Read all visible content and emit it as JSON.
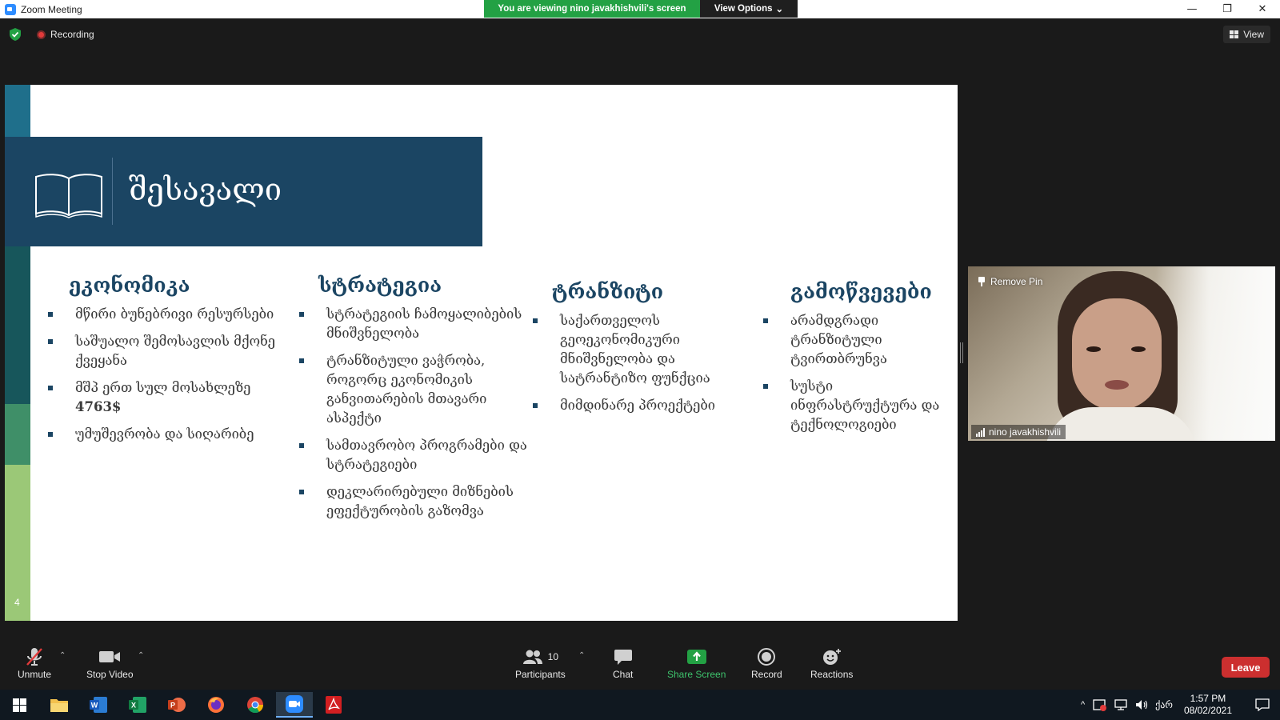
{
  "window": {
    "title": "Zoom Meeting",
    "minimize": "—",
    "maximize": "❐",
    "close": "✕"
  },
  "banner": {
    "text": "You are viewing nino javakhishvili's screen",
    "view_options": "View Options",
    "caret": "⌄"
  },
  "top": {
    "recording": "Recording",
    "view": "View"
  },
  "slide": {
    "title": "შესავალი",
    "number": "4",
    "colors": {
      "title_bg": "#1b4563",
      "accent_teal": "#1f6f8b",
      "accent_green": "#4caf7a"
    },
    "columns": [
      {
        "heading": "ეკონომიკა",
        "items": [
          "მწირი ბუნებრივი რესურსები",
          "საშუალო შემოსავლის მქონე ქვეყანა",
          "მშპ ერთ სულ მოსახლეზე",
          "უმუშევრობა და სიღარიბე"
        ],
        "emphasis": "4763$"
      },
      {
        "heading": "სტრატეგია",
        "items": [
          "სტრატეგიის ჩამოყალიბების მნიშვნელობა",
          "ტრანზიტული ვაჭრობა, როგორც ეკონომიკის განვითარების მთავარი ასპექტი",
          "სამთავრობო პროგრამები  და სტრატეგიები",
          "დეკლარირებული მიზნების ეფექტურობის გაზომვა"
        ]
      },
      {
        "heading": "ტრანზიტი",
        "items": [
          "საქართველოს გეოეკონომიკური მნიშვნელობა და სატრანტიზო ფუნქცია",
          "მიმდინარე პროექტები"
        ]
      },
      {
        "heading": "გამოწვევები",
        "items": [
          "არამდგრადი ტრანზიტული ტვირთბრუნვა",
          "სუსტი ინფრასტრუქტურა და ტექნოლოგიები"
        ]
      }
    ]
  },
  "video": {
    "remove_pin": "Remove Pin",
    "participant_name": "nino javakhishvili"
  },
  "toolbar": {
    "unmute": "Unmute",
    "stop_video": "Stop Video",
    "participants": "Participants",
    "participants_count": "10",
    "chat": "Chat",
    "share_screen": "Share Screen",
    "record": "Record",
    "reactions": "Reactions",
    "leave": "Leave",
    "caret": "⌃"
  },
  "taskbar": {
    "language": "ქარ",
    "time": "1:57 PM",
    "date": "08/02/2021",
    "tray_up": "^"
  }
}
